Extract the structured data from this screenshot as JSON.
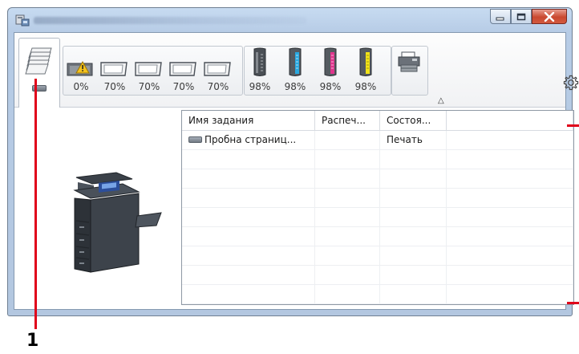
{
  "window": {
    "title_redacted": true,
    "caption_buttons": [
      "minimize",
      "maximize",
      "close"
    ]
  },
  "toolbar": {
    "tabs": [
      {
        "icon": "printer-queue-icon",
        "active": true
      }
    ],
    "trays": [
      {
        "icon": "paper-tray-warning-icon",
        "level_label": "0%",
        "warning": true
      },
      {
        "icon": "paper-tray-icon",
        "level_label": "70%"
      },
      {
        "icon": "paper-tray-icon",
        "level_label": "70%"
      },
      {
        "icon": "paper-tray-icon",
        "level_label": "70%"
      },
      {
        "icon": "paper-tray-icon",
        "level_label": "70%"
      }
    ],
    "toners": [
      {
        "color_name": "black",
        "color": "#3c3c3c",
        "level_label": "98%",
        "level": 0.98
      },
      {
        "color_name": "cyan",
        "color": "#29a9e0",
        "level_label": "98%",
        "level": 0.98
      },
      {
        "color_name": "magenta",
        "color": "#e0348c",
        "level_label": "98%",
        "level": 0.98
      },
      {
        "color_name": "yellow",
        "color": "#f2e318",
        "level_label": "98%",
        "level": 0.98
      }
    ],
    "expand_icon": "chevron-up-icon",
    "settings_icon": "gear-icon"
  },
  "job_table": {
    "columns": [
      "Имя задания",
      "Распеч...",
      "Состоя...",
      ""
    ],
    "rows": [
      {
        "name": "Пробна страниц...",
        "printed": "",
        "status": "Печать"
      }
    ],
    "empty_rows": 8
  },
  "callout": {
    "label": "1",
    "color": "#e0001a"
  }
}
